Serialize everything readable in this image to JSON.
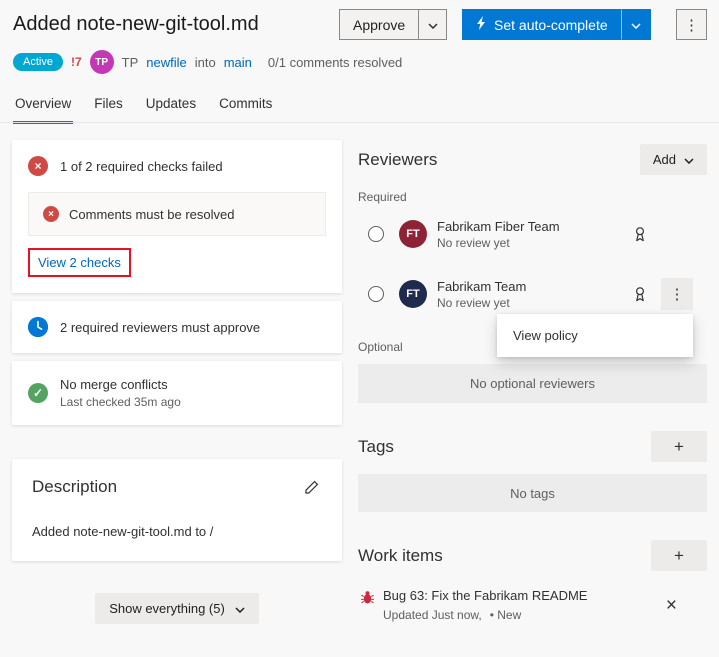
{
  "header": {
    "title": "Added note-new-git-tool.md",
    "approve_label": "Approve",
    "auto_complete_label": "Set auto-complete",
    "status_badge": "Active",
    "alert_count": "!7",
    "author_initials": "TP",
    "author_name": "TP",
    "source_branch": "newfile",
    "into_label": "into",
    "target_branch": "main",
    "comments_resolved": "0/1 comments resolved"
  },
  "tabs": [
    {
      "label": "Overview",
      "active": true
    },
    {
      "label": "Files",
      "active": false
    },
    {
      "label": "Updates",
      "active": false
    },
    {
      "label": "Commits",
      "active": false
    }
  ],
  "checks": {
    "failed_summary": "1 of 2 required checks failed",
    "comments_check": "Comments must be resolved",
    "view_link": "View 2 checks",
    "reviewers_required": "2 required reviewers must approve",
    "merge_title": "No merge conflicts",
    "merge_sub": "Last checked 35m ago"
  },
  "description": {
    "title": "Description",
    "body": "Added note-new-git-tool.md to /"
  },
  "footer": {
    "show_everything": "Show everything (5)"
  },
  "reviewers": {
    "title": "Reviewers",
    "add_label": "Add",
    "required_label": "Required",
    "optional_label": "Optional",
    "no_optional": "No optional reviewers",
    "items": [
      {
        "initials": "FT",
        "name": "Fabrikam Fiber Team",
        "status": "No review yet",
        "avatar_color": "#8f2336"
      },
      {
        "initials": "FT",
        "name": "Fabrikam Team",
        "status": "No review yet",
        "avatar_color": "#1f2a4d"
      }
    ],
    "context_menu": {
      "view_policy": "View policy"
    }
  },
  "tags": {
    "title": "Tags",
    "empty": "No tags"
  },
  "work_items": {
    "title": "Work items",
    "items": [
      {
        "type": "Bug",
        "title": "Bug 63: Fix the Fabrikam README",
        "updated": "Updated Just now,",
        "state": "• New"
      }
    ]
  },
  "icons": {
    "kebab": "⋮",
    "plus": "+",
    "close": "×",
    "check": "✓",
    "cross": "×"
  },
  "colors": {
    "accent": "#0078d4",
    "active_badge": "#00a7d1",
    "error": "#cd4a45",
    "success": "#55a362",
    "annotation": "#e81123",
    "author_avatar": "#c239b3",
    "link": "#0067b8"
  }
}
